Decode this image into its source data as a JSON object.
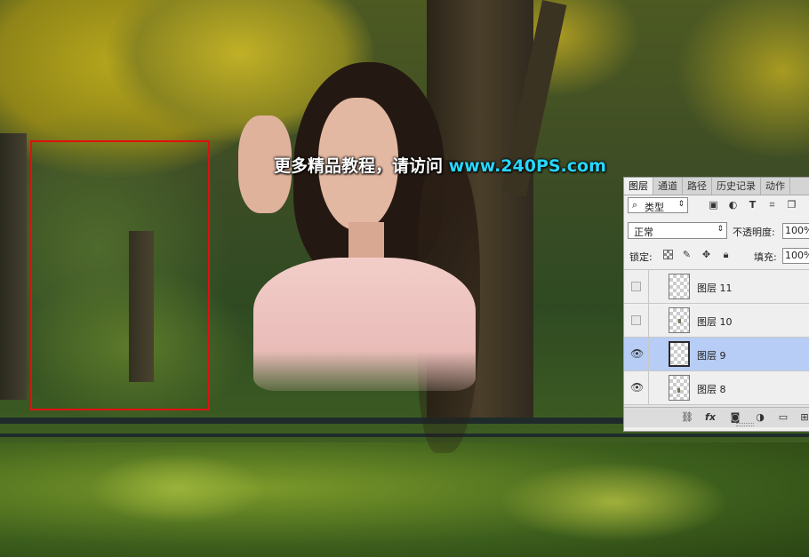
{
  "watermark": {
    "part1": "更多精品教程，请访问 ",
    "part2": "www.240PS.com"
  },
  "panel": {
    "tabs": [
      {
        "label": "图层",
        "active": true
      },
      {
        "label": "通道",
        "active": false
      },
      {
        "label": "路径",
        "active": false
      },
      {
        "label": "历史记录",
        "active": false
      },
      {
        "label": "动作",
        "active": false
      }
    ],
    "filter": {
      "kind_label": "类型",
      "icons": [
        "pixel-filter-icon",
        "adjustment-filter-icon",
        "type-filter-icon",
        "shape-filter-icon",
        "smart-object-filter-icon"
      ]
    },
    "blend_mode": "正常",
    "opacity_label": "不透明度:",
    "opacity_value": "100%",
    "lock_label": "锁定:",
    "fill_label": "填充:",
    "fill_value": "100%",
    "layers": [
      {
        "name": "图层 11",
        "visible": false,
        "selected": false
      },
      {
        "name": "图层 10",
        "visible": false,
        "selected": false
      },
      {
        "name": "图层 9",
        "visible": true,
        "selected": true
      },
      {
        "name": "图层 8",
        "visible": true,
        "selected": false
      }
    ],
    "bottom_icons": [
      "link-layers-icon",
      "fx-icon",
      "add-mask-icon",
      "adjustment-layer-icon",
      "new-group-icon",
      "new-layer-icon"
    ],
    "fx_label": "fx"
  },
  "colors": {
    "selection": "#e01010",
    "watermark_url": "#27d7ff",
    "selected_layer": "#b7cdf5"
  }
}
